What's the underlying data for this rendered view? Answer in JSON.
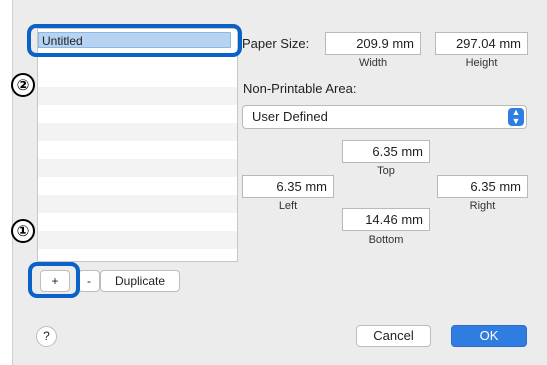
{
  "list": {
    "selected_name": "Untitled"
  },
  "callouts": {
    "one": "①",
    "two": "②"
  },
  "list_buttons": {
    "add": "+",
    "remove": "-",
    "duplicate": "Duplicate"
  },
  "paper_size": {
    "label": "Paper Size:",
    "width_value": "209.9 mm",
    "height_value": "297.04 mm",
    "width_caption": "Width",
    "height_caption": "Height"
  },
  "non_printable": {
    "label": "Non-Printable Area:",
    "selected": "User Defined",
    "top_value": "6.35 mm",
    "top_caption": "Top",
    "left_value": "6.35 mm",
    "left_caption": "Left",
    "right_value": "6.35 mm",
    "right_caption": "Right",
    "bottom_value": "14.46 mm",
    "bottom_caption": "Bottom"
  },
  "footer": {
    "help": "?",
    "cancel": "Cancel",
    "ok": "OK"
  },
  "colors": {
    "accent": "#0a62c9",
    "ok_button": "#2f7de1"
  }
}
